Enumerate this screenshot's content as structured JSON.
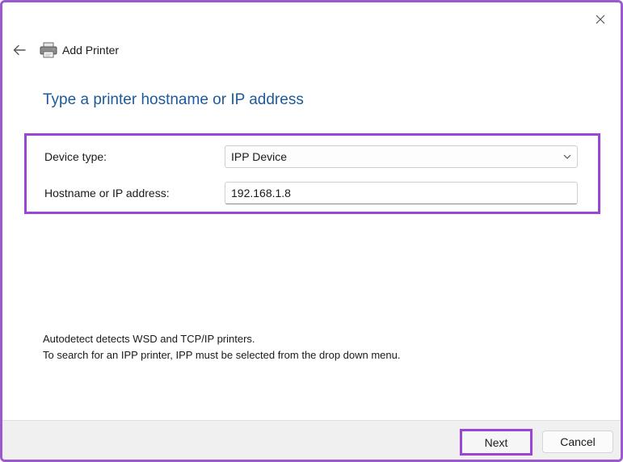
{
  "window": {
    "title": "Add Printer",
    "icons": {
      "close": "close-icon",
      "back": "back-arrow-icon",
      "app": "printer-icon"
    }
  },
  "page": {
    "heading": "Type a printer hostname or IP address"
  },
  "form": {
    "device_type_label": "Device type:",
    "device_type_value": "IPP Device",
    "hostname_label": "Hostname or IP address:",
    "hostname_value": "192.168.1.8"
  },
  "info": {
    "line1": "Autodetect detects WSD and TCP/IP printers.",
    "line2": "To search for an IPP printer, IPP must be selected from the drop down menu."
  },
  "footer": {
    "next_label": "Next",
    "cancel_label": "Cancel"
  },
  "colors": {
    "heading": "#1c5a9c",
    "highlight": "#9b45d6",
    "footer_bg": "#f0f0f0"
  }
}
